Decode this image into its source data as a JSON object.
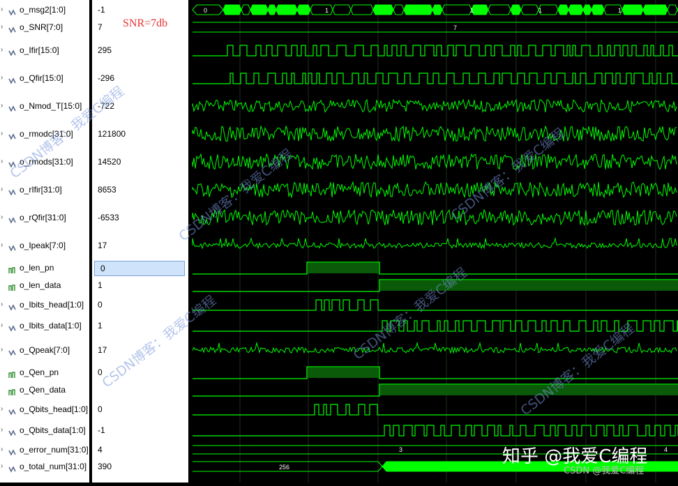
{
  "annotation": "SNR=7db",
  "signals": [
    {
      "name": "o_msg2[1:0]",
      "value": "-1",
      "kind": "bus",
      "bus_labels": [
        "0",
        "1",
        "1",
        "1",
        "1"
      ]
    },
    {
      "name": "o_SNR[7:0]",
      "value": "7",
      "kind": "bus",
      "bus_labels": [
        "7"
      ]
    },
    {
      "name": "o_Ifir[15:0]",
      "value": "295",
      "kind": "digital"
    },
    {
      "name": "o_Qfir[15:0]",
      "value": "-296",
      "kind": "digital"
    },
    {
      "name": "o_Nmod_T[15:0]",
      "value": "-722",
      "kind": "analog"
    },
    {
      "name": "o_rmodc[31:0]",
      "value": "121800",
      "kind": "analog"
    },
    {
      "name": "o_rmods[31:0]",
      "value": "14520",
      "kind": "analog"
    },
    {
      "name": "o_rIfir[31:0]",
      "value": "8653",
      "kind": "analog"
    },
    {
      "name": "o_rQfir[31:0]",
      "value": "-6533",
      "kind": "analog"
    },
    {
      "name": "o_Ipeak[7:0]",
      "value": "17",
      "kind": "analog"
    },
    {
      "name": "o_len_pn",
      "value": "0",
      "kind": "bit",
      "selected": true
    },
    {
      "name": "o_len_data",
      "value": "1",
      "kind": "bit"
    },
    {
      "name": "o_Ibits_head[1:0]",
      "value": "0",
      "kind": "digital"
    },
    {
      "name": "o_Ibits_data[1:0]",
      "value": "1",
      "kind": "digital"
    },
    {
      "name": "o_Qpeak[7:0]",
      "value": "17",
      "kind": "analog"
    },
    {
      "name": "o_Qen_pn",
      "value": "0",
      "kind": "bit"
    },
    {
      "name": "o_Qen_data",
      "value": "",
      "kind": "bit"
    },
    {
      "name": "o_Qbits_head[1:0]",
      "value": "0",
      "kind": "digital"
    },
    {
      "name": "o_Qbits_data[1:0]",
      "value": "-1",
      "kind": "digital"
    },
    {
      "name": "o_error_num[31:0]",
      "value": "4",
      "kind": "bus",
      "bus_labels": [
        "3",
        "4"
      ]
    },
    {
      "name": "o_total_num[31:0]",
      "value": "390",
      "kind": "bus",
      "bus_labels": [
        "256"
      ]
    }
  ],
  "watermarks": [
    "CSDN博客：我爱C编程",
    "CSDN博客：我爱C编程",
    "CSDN博客：我爱C编程",
    "CSDN博客：我爱C编程",
    "CSDN博客：我爱C编程",
    "CSDN博客：我爱C编程"
  ],
  "brand_text": "知乎 @我爱C编程",
  "credit_text": "CSDN @我爱C编程",
  "colors": {
    "wave": "#00ff00",
    "grid": "#1c2e1c",
    "snr_label": "#e63232"
  }
}
